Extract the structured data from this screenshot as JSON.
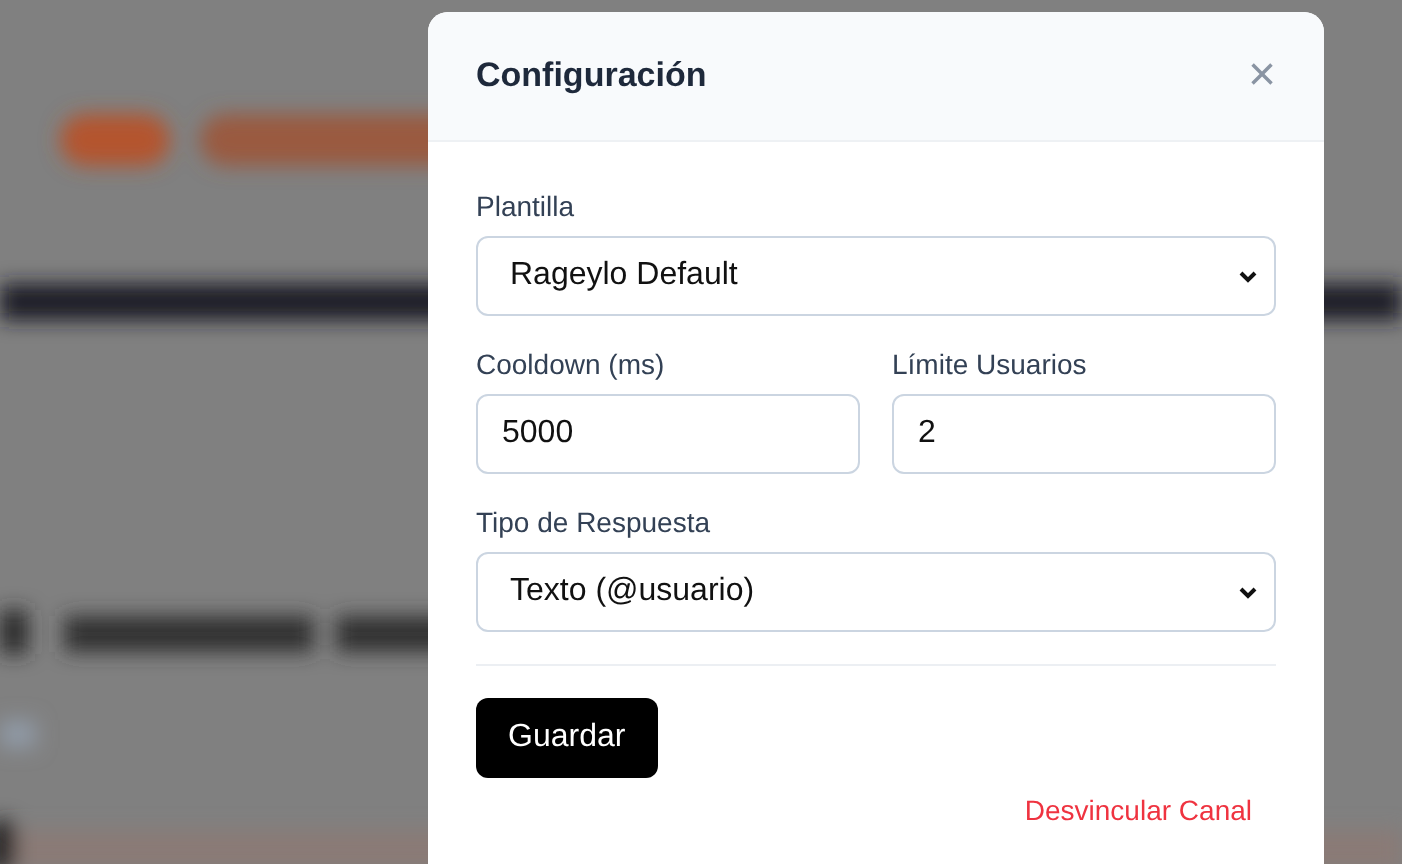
{
  "dialog": {
    "title": "Configuración",
    "close": "×",
    "rows": [
      {
        "fields": [
          {
            "kind": "select",
            "label": "Plantilla",
            "value": "Rageylo Default"
          }
        ]
      },
      {
        "fields": [
          {
            "kind": "input",
            "label": "Cooldown (ms)",
            "value": "5000"
          },
          {
            "kind": "input",
            "label": "Límite Usuarios",
            "value": "2"
          }
        ]
      },
      {
        "fields": [
          {
            "kind": "select",
            "label": "Tipo de Respuesta",
            "value": "Texto (@usuario)"
          }
        ]
      }
    ],
    "save_button": "Guardar",
    "unlink_link": "Desvincular Canal"
  }
}
